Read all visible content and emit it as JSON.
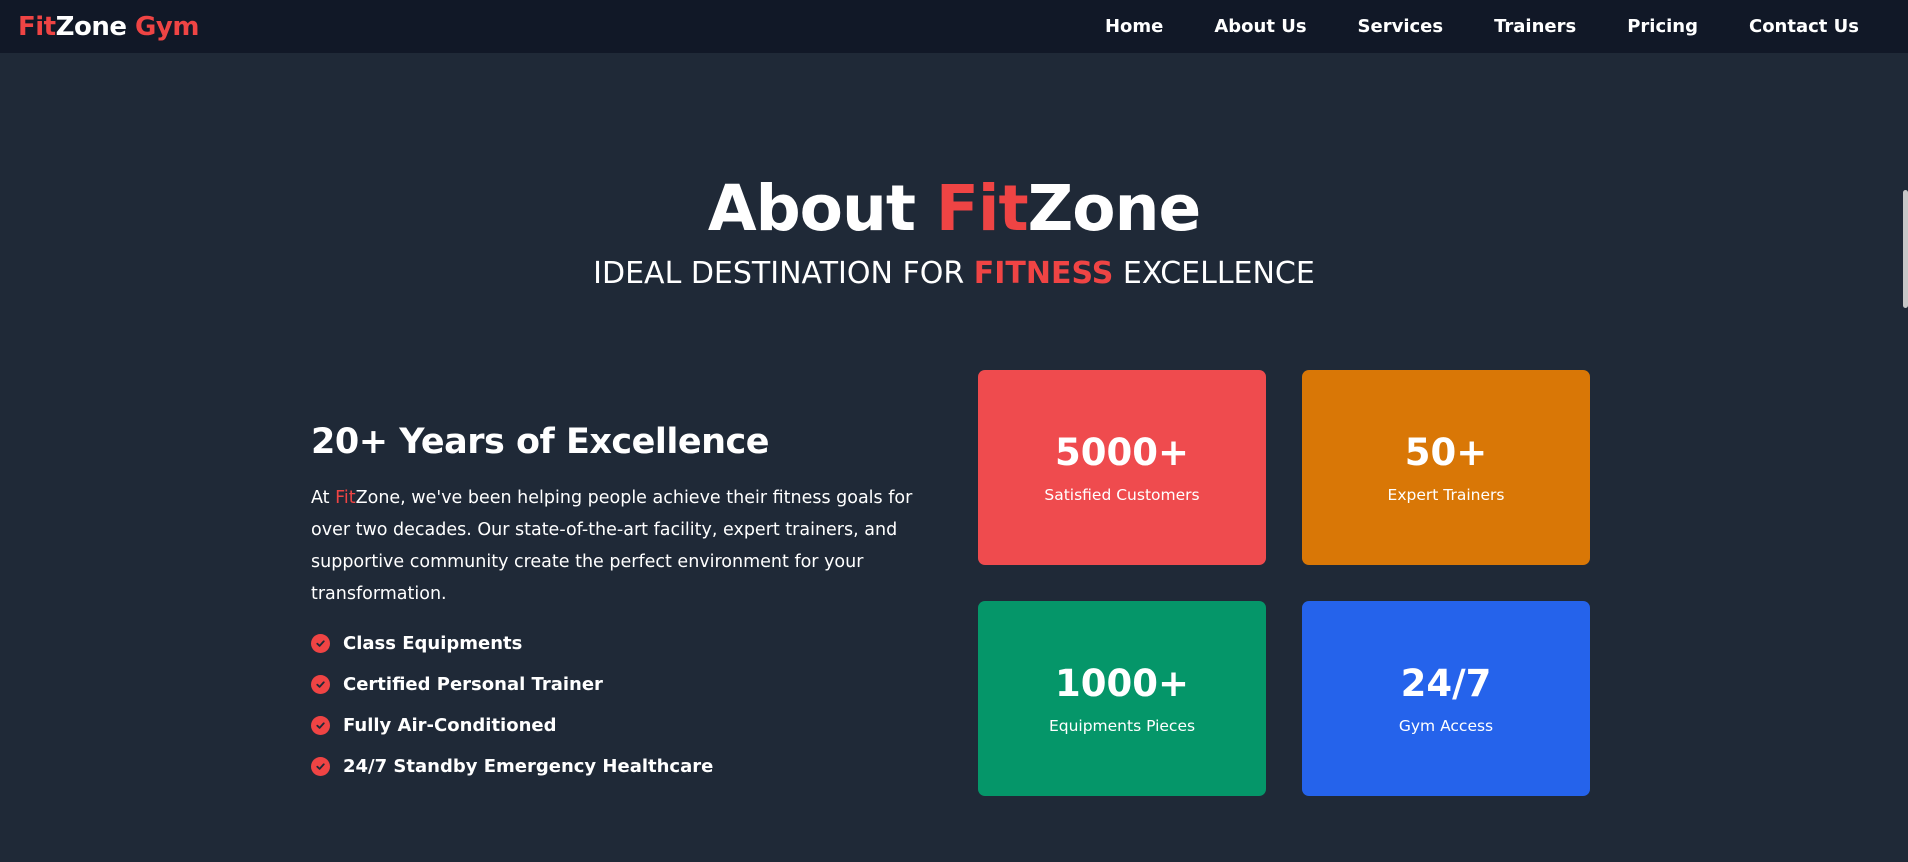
{
  "nav": {
    "logo": {
      "part1": "Fit",
      "part2": "Zone",
      "part3": "Gym"
    },
    "links": [
      "Home",
      "About Us",
      "Services",
      "Trainers",
      "Pricing",
      "Contact Us"
    ]
  },
  "hero": {
    "title_part1": "About ",
    "title_part2": "Fit",
    "title_part3": "Zone",
    "subtitle_part1": "IDEAL DESTINATION FOR ",
    "subtitle_part2": "FITNESS",
    "subtitle_part3": " EXCELLENCE"
  },
  "about": {
    "heading": "20+ Years of Excellence",
    "para_part1": "At ",
    "para_part2": "Fit",
    "para_part3": "Zone, we've been helping people achieve their fitness goals for over two decades. Our state-of-the-art facility, expert trainers, and supportive community create the perfect environment for your transformation.",
    "features": [
      "Class Equipments",
      "Certified Personal Trainer",
      "Fully Air-Conditioned",
      "24/7 Standby Emergency Healthcare"
    ]
  },
  "stats": [
    {
      "value": "5000+",
      "label": "Satisfied Customers",
      "color": "#ef4b4e"
    },
    {
      "value": "50+",
      "label": "Expert Trainers",
      "color": "#d97706"
    },
    {
      "value": "1000+",
      "label": "Equipments Pieces",
      "color": "#059669"
    },
    {
      "value": "24/7",
      "label": "Gym Access",
      "color": "#2563eb"
    }
  ],
  "icons": {
    "check": "check-circle-icon"
  },
  "colors": {
    "accent": "#ef4444",
    "background": "#1f2937",
    "nav_background": "#111827"
  }
}
